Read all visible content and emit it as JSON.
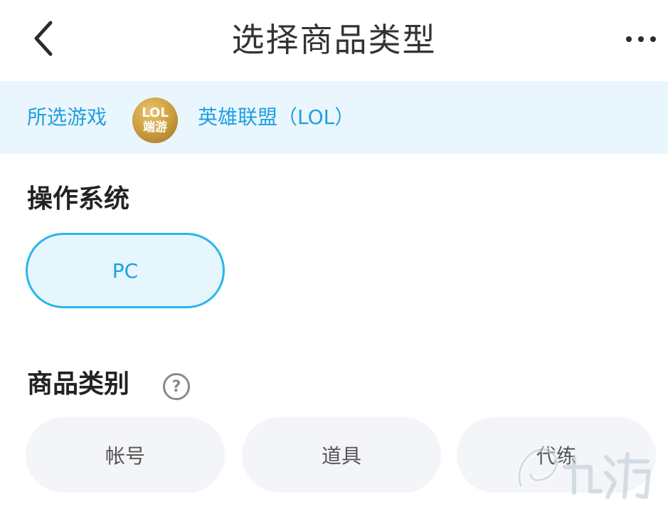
{
  "header": {
    "title": "选择商品类型",
    "back_icon": "chevron-left-icon",
    "more_icon": "more-horizontal-icon"
  },
  "game": {
    "label": "所选游戏",
    "logo_line1": "LOL",
    "logo_line2": "端游",
    "name": "英雄联盟（LOL）"
  },
  "os": {
    "title": "操作系统",
    "options": [
      {
        "label": "PC",
        "selected": true
      }
    ]
  },
  "category": {
    "title": "商品类别",
    "help_glyph": "?",
    "options": [
      {
        "label": "帐号",
        "selected": false
      },
      {
        "label": "道具",
        "selected": false
      },
      {
        "label": "代练",
        "selected": false
      }
    ]
  },
  "colors": {
    "accent": "#1ea0e0",
    "accent_border": "#29b6ec",
    "game_bar_bg": "#eaf6fd",
    "selected_bg": "#e6f6fd",
    "pill_bg": "#f3f5f8"
  }
}
